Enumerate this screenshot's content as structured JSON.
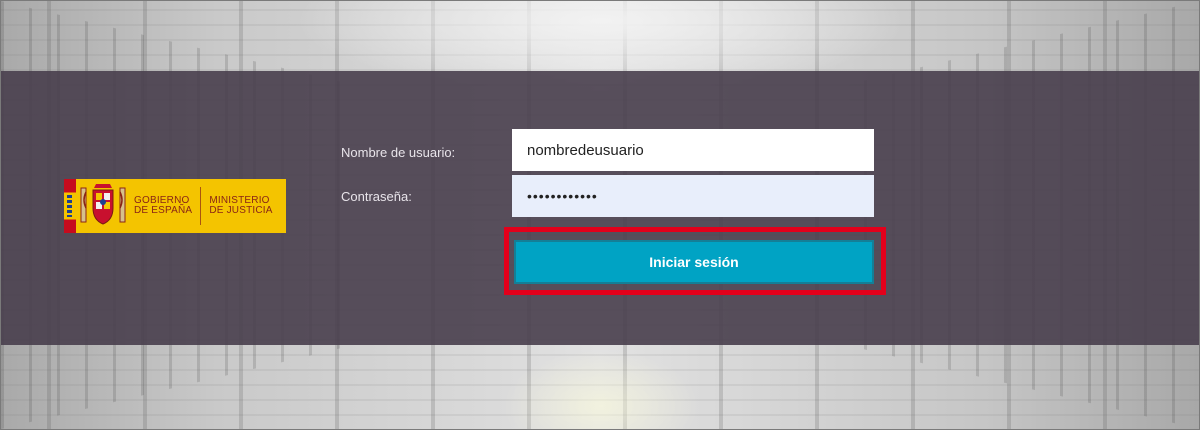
{
  "logo": {
    "line1": "GOBIERNO",
    "line2": "DE ESPAÑA",
    "line3": "MINISTERIO",
    "line4": "DE JUSTICIA"
  },
  "form": {
    "username_label": "Nombre de usuario:",
    "username_value": "nombredeusuario",
    "password_label": "Contraseña:",
    "password_value": "••••••••••••",
    "submit_label": "Iniciar sesión"
  },
  "colors": {
    "band": "#483e4c",
    "button": "#00a3c4",
    "highlight": "#e3001b",
    "logo_yellow": "#f4c400",
    "logo_text": "#8a2515"
  },
  "icons": [
    "coat-of-arms-icon",
    "spain-flag-icon"
  ]
}
